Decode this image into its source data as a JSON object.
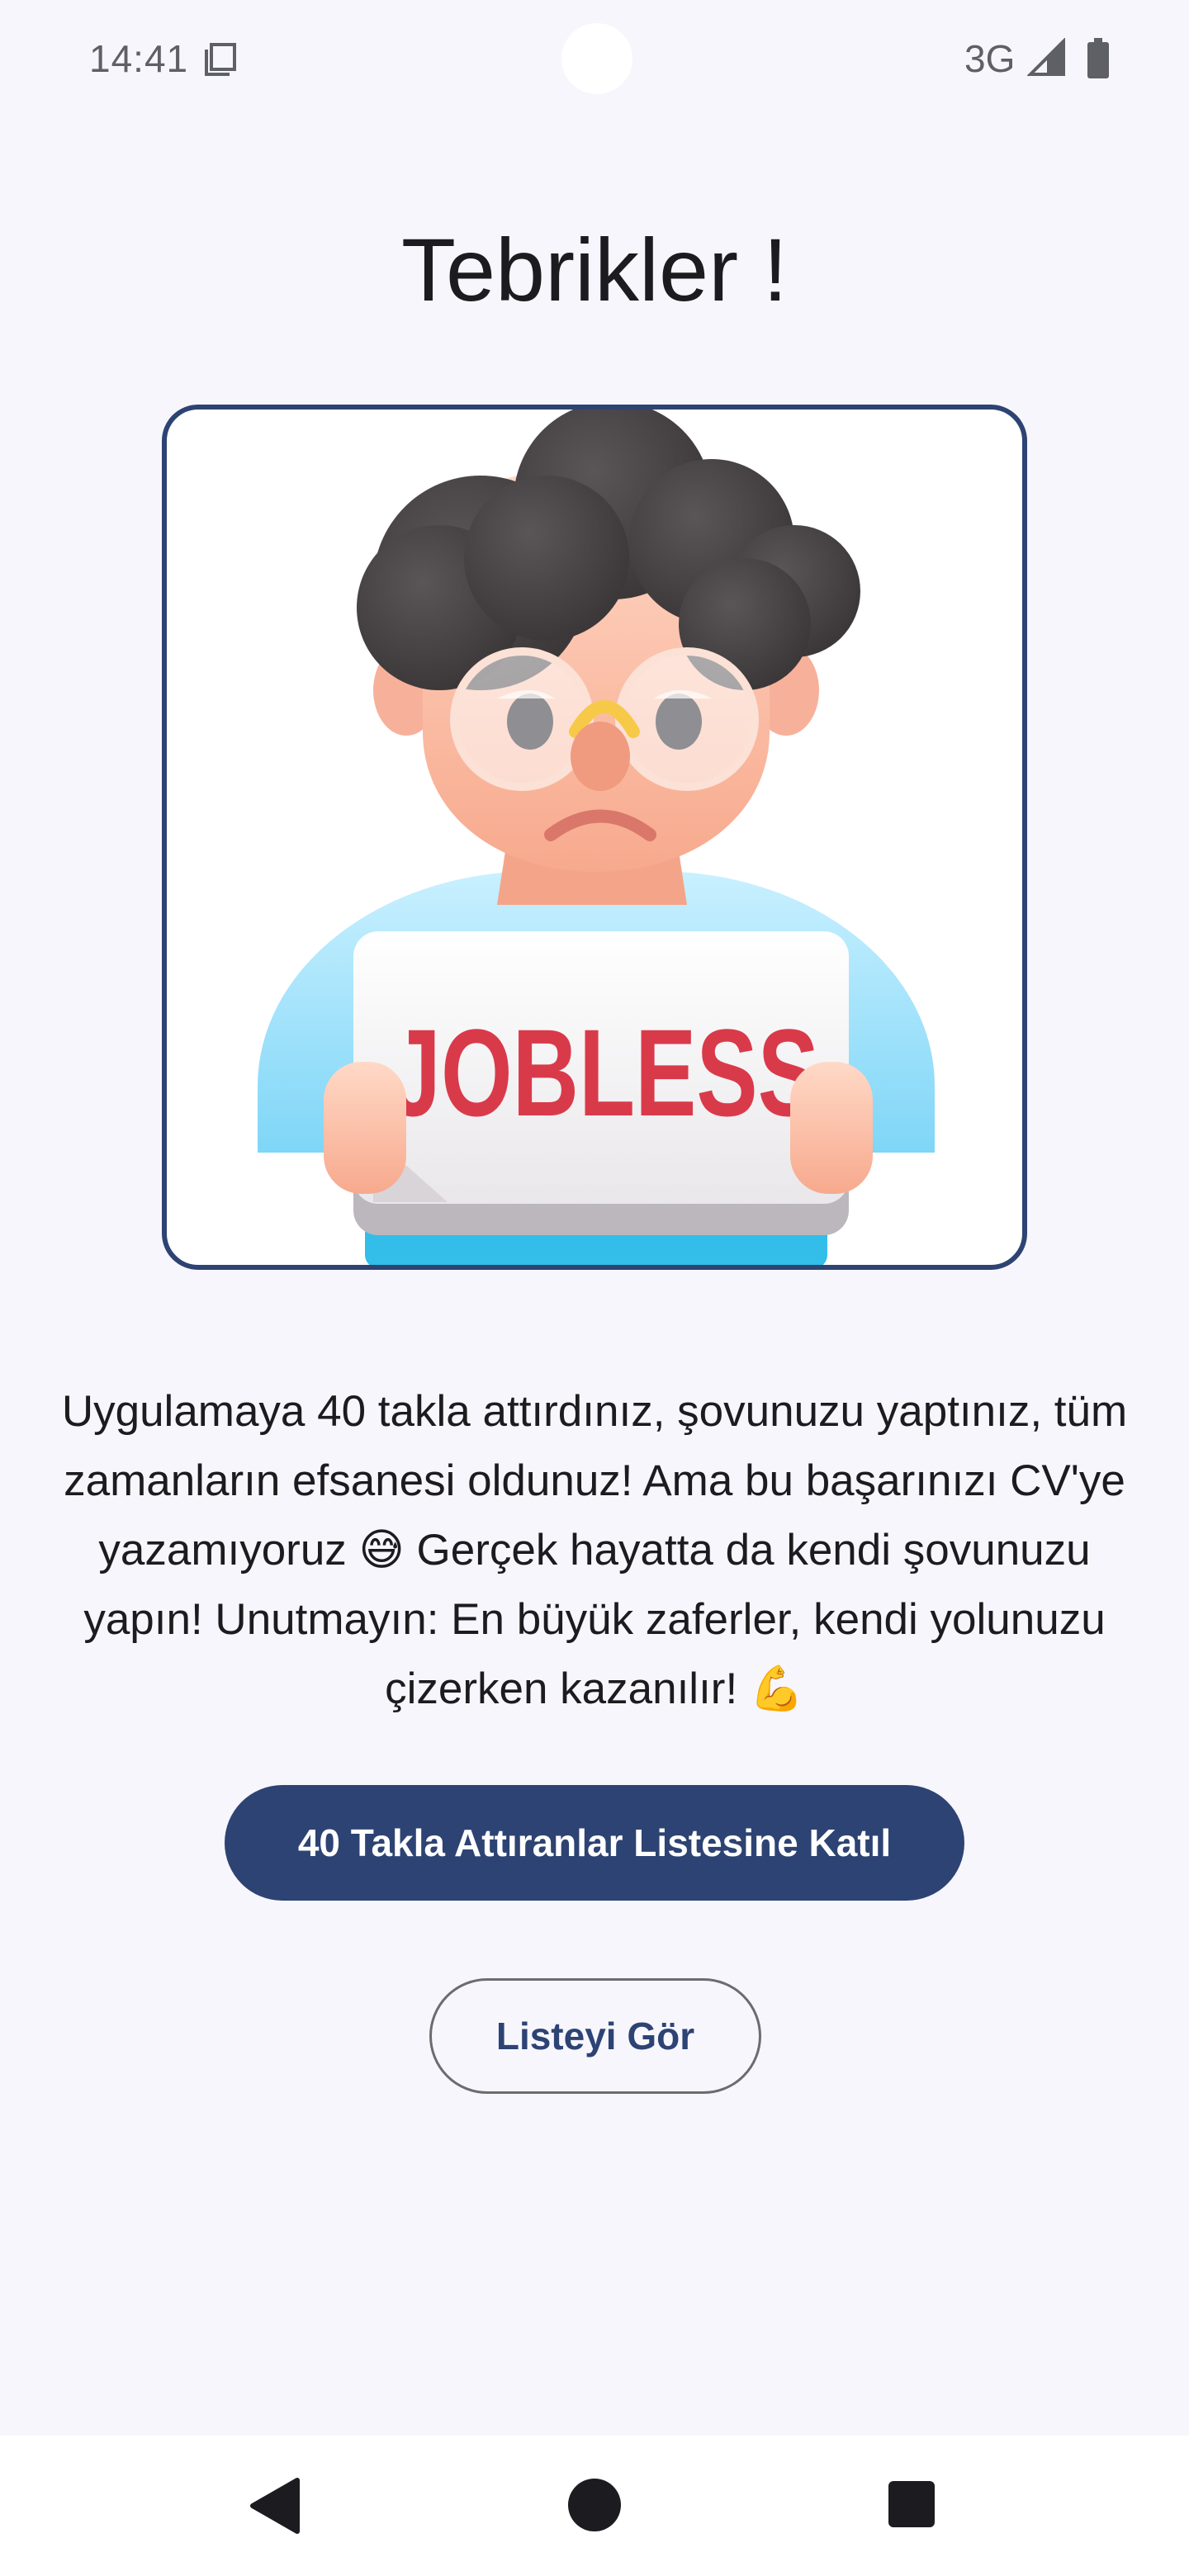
{
  "status_bar": {
    "time": "14:41",
    "network": "3G",
    "icons": [
      "sd-card-icon",
      "signal-icon",
      "battery-icon"
    ]
  },
  "page": {
    "title": "Tebrikler !",
    "illustration_sign_text": "JOBLESS",
    "message": "Uygulamaya 40 takla attırdınız, şovunuzu yaptınız, tüm zamanların efsanesi oldunuz! Ama bu başarınızı CV'ye yazamıyoruz 😅 Gerçek hayatta da kendi şovunuzu yapın! Unutmayın: En büyük zaferler, kendi yolunuzu çizerken kazanılır! 💪"
  },
  "buttons": {
    "join_list": "40 Takla Attıranlar Listesine Katıl",
    "view_list": "Listeyi Gör"
  },
  "nav_bar": {
    "icons": [
      "back-icon",
      "home-icon",
      "recents-icon"
    ]
  },
  "colors": {
    "primary": "#2d4373",
    "background": "#f7f6fc",
    "sign_text": "#d93a4a"
  }
}
